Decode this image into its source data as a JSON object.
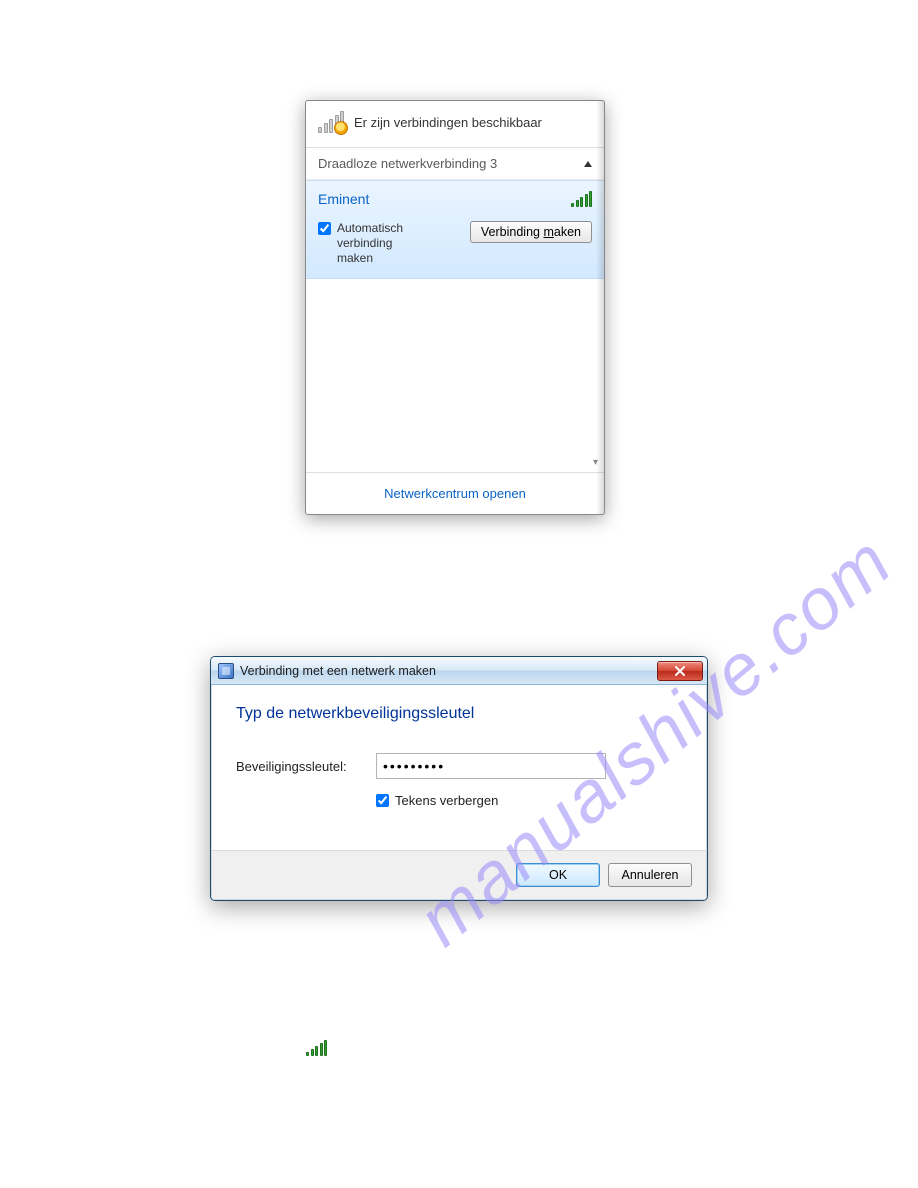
{
  "flyout": {
    "header_text": "Er zijn verbindingen beschikbaar",
    "adapter_label": "Draadloze netwerkverbinding 3",
    "network_name": "Eminent",
    "auto_connect_label": "Automatisch verbinding maken",
    "auto_connect_checked": true,
    "connect_button_prefix": "Verbinding ",
    "connect_button_key": "m",
    "connect_button_suffix": "aken",
    "footer_link": "Netwerkcentrum openen"
  },
  "dialog": {
    "title": "Verbinding met een netwerk maken",
    "heading": "Typ de netwerkbeveiligingssleutel",
    "field_label": "Beveiligingssleutel:",
    "field_value": "●●●●●●●●●",
    "hide_chars_label": "Tekens verbergen",
    "hide_chars_checked": true,
    "ok_label": "OK",
    "cancel_label": "Annuleren"
  },
  "watermark": "manualshive.com"
}
